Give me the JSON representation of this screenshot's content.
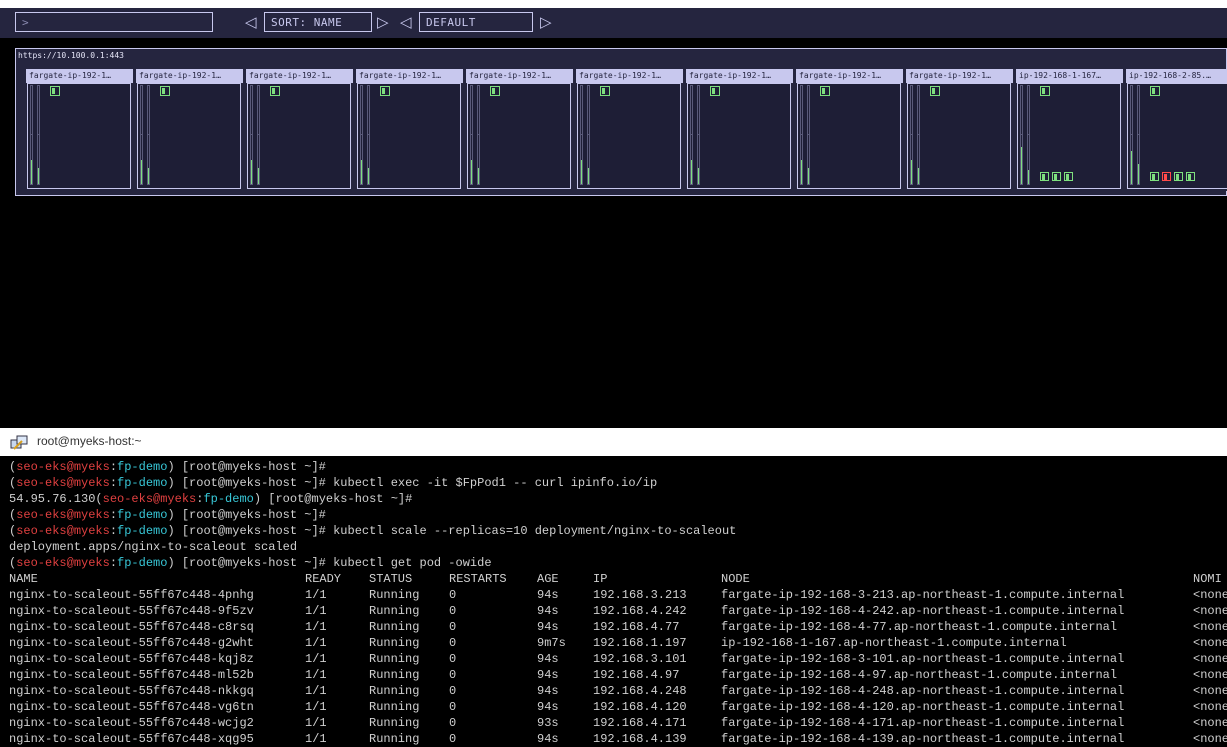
{
  "toolbar": {
    "filter_placeholder": ">",
    "sort_label": "SORT: NAME",
    "theme_label": "DEFAULT",
    "prev_icon": "triangle-left-icon",
    "next_icon": "triangle-right-icon"
  },
  "cluster": {
    "url": "https://10.100.0.1:443",
    "nodes": [
      {
        "name": "fargate-ip-192-1…",
        "cpu": 0.25,
        "mem": 0.16,
        "pods": []
      },
      {
        "name": "fargate-ip-192-1…",
        "cpu": 0.25,
        "mem": 0.16,
        "pods": []
      },
      {
        "name": "fargate-ip-192-1…",
        "cpu": 0.25,
        "mem": 0.16,
        "pods": []
      },
      {
        "name": "fargate-ip-192-1…",
        "cpu": 0.25,
        "mem": 0.16,
        "pods": []
      },
      {
        "name": "fargate-ip-192-1…",
        "cpu": 0.25,
        "mem": 0.16,
        "pods": []
      },
      {
        "name": "fargate-ip-192-1…",
        "cpu": 0.25,
        "mem": 0.16,
        "pods": []
      },
      {
        "name": "fargate-ip-192-1…",
        "cpu": 0.25,
        "mem": 0.16,
        "pods": []
      },
      {
        "name": "fargate-ip-192-1…",
        "cpu": 0.25,
        "mem": 0.16,
        "pods": []
      },
      {
        "name": "fargate-ip-192-1…",
        "cpu": 0.25,
        "mem": 0.16,
        "pods": []
      },
      {
        "name": "ip-192-168-1-167…",
        "cpu": 0.38,
        "mem": 0.14,
        "pods": [
          "ok",
          "ok",
          "ok"
        ]
      },
      {
        "name": "ip-192-168-2-85.…",
        "cpu": 0.34,
        "mem": 0.2,
        "pods": [
          "ok",
          "error",
          "ok",
          "ok"
        ]
      }
    ]
  },
  "terminal": {
    "title": "root@myeks-host:~",
    "lines": [
      {
        "ctx_user": "seo-eks@myeks",
        "ctx_ns": "fp-demo",
        "prompt": " [root@myeks-host ~]#",
        "cmd": ""
      },
      {
        "ctx_user": "seo-eks@myeks",
        "ctx_ns": "fp-demo",
        "prompt": " [root@myeks-host ~]#",
        "cmd": " kubectl exec -it $FpPod1 -- curl ipinfo.io/ip"
      },
      {
        "prefix": "54.95.76.130",
        "ctx_user": "seo-eks@myeks",
        "ctx_ns": "fp-demo",
        "prompt": " [root@myeks-host ~]#",
        "cmd": ""
      },
      {
        "ctx_user": "seo-eks@myeks",
        "ctx_ns": "fp-demo",
        "prompt": " [root@myeks-host ~]#",
        "cmd": ""
      },
      {
        "ctx_user": "seo-eks@myeks",
        "ctx_ns": "fp-demo",
        "prompt": " [root@myeks-host ~]#",
        "cmd": " kubectl scale --replicas=10 deployment/nginx-to-scaleout"
      },
      {
        "output": "deployment.apps/nginx-to-scaleout scaled"
      },
      {
        "ctx_user": "seo-eks@myeks",
        "ctx_ns": "fp-demo",
        "prompt": " [root@myeks-host ~]#",
        "cmd": " kubectl get pod -owide"
      }
    ],
    "table": {
      "headers": [
        "NAME",
        "READY",
        "STATUS",
        "RESTARTS",
        "AGE",
        "IP",
        "NODE",
        "NOMI"
      ],
      "rows": [
        [
          "nginx-to-scaleout-55ff67c448-4pnhg",
          "1/1",
          "Running",
          "0",
          "94s",
          "192.168.3.213",
          "fargate-ip-192-168-3-213.ap-northeast-1.compute.internal",
          "<none"
        ],
        [
          "nginx-to-scaleout-55ff67c448-9f5zv",
          "1/1",
          "Running",
          "0",
          "94s",
          "192.168.4.242",
          "fargate-ip-192-168-4-242.ap-northeast-1.compute.internal",
          "<none"
        ],
        [
          "nginx-to-scaleout-55ff67c448-c8rsq",
          "1/1",
          "Running",
          "0",
          "94s",
          "192.168.4.77",
          "fargate-ip-192-168-4-77.ap-northeast-1.compute.internal",
          "<none"
        ],
        [
          "nginx-to-scaleout-55ff67c448-g2wht",
          "1/1",
          "Running",
          "0",
          "9m7s",
          "192.168.1.197",
          "ip-192-168-1-167.ap-northeast-1.compute.internal",
          "<none"
        ],
        [
          "nginx-to-scaleout-55ff67c448-kqj8z",
          "1/1",
          "Running",
          "0",
          "94s",
          "192.168.3.101",
          "fargate-ip-192-168-3-101.ap-northeast-1.compute.internal",
          "<none"
        ],
        [
          "nginx-to-scaleout-55ff67c448-ml52b",
          "1/1",
          "Running",
          "0",
          "94s",
          "192.168.4.97",
          "fargate-ip-192-168-4-97.ap-northeast-1.compute.internal",
          "<none"
        ],
        [
          "nginx-to-scaleout-55ff67c448-nkkgq",
          "1/1",
          "Running",
          "0",
          "94s",
          "192.168.4.248",
          "fargate-ip-192-168-4-248.ap-northeast-1.compute.internal",
          "<none"
        ],
        [
          "nginx-to-scaleout-55ff67c448-vg6tn",
          "1/1",
          "Running",
          "0",
          "94s",
          "192.168.4.120",
          "fargate-ip-192-168-4-120.ap-northeast-1.compute.internal",
          "<none"
        ],
        [
          "nginx-to-scaleout-55ff67c448-wcjg2",
          "1/1",
          "Running",
          "0",
          "93s",
          "192.168.4.171",
          "fargate-ip-192-168-4-171.ap-northeast-1.compute.internal",
          "<none"
        ],
        [
          "nginx-to-scaleout-55ff67c448-xqg95",
          "1/1",
          "Running",
          "0",
          "94s",
          "192.168.4.139",
          "fargate-ip-192-168-4-139.ap-northeast-1.compute.internal",
          "<none"
        ]
      ]
    }
  },
  "colors": {
    "panel": "#25253f",
    "border": "#c8c8ee",
    "ok": "#7ee07e",
    "error": "#ff4b4b",
    "ctx_user": "#e04040",
    "ctx_ns": "#38c8d8"
  }
}
